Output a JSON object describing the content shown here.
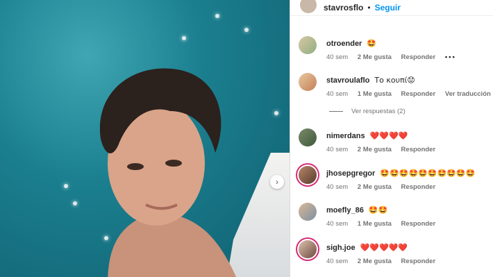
{
  "header": {
    "owner": "stavrosflo",
    "separator": "•",
    "follow_label": "Seguir"
  },
  "comments": [
    {
      "user": "otroender",
      "text": "🤩",
      "time": "40 sem",
      "likes": "2 Me gusta",
      "reply": "Responder",
      "more": "•••"
    },
    {
      "user": "stavroulaflo",
      "text": "Το κουπί😟",
      "time": "40 sem",
      "likes": "1 Me gusta",
      "reply": "Responder",
      "translate": "Ver traducción"
    },
    {
      "user": "nimerdans",
      "text": "❤️❤️❤️❤️",
      "time": "40 sem",
      "likes": "2 Me gusta",
      "reply": "Responder"
    },
    {
      "user": "jhosepgregor",
      "text": "🤩🤩🤩🤩🤩🤩🤩🤩🤩🤩",
      "time": "40 sem",
      "likes": "2 Me gusta",
      "reply": "Responder"
    },
    {
      "user": "moefly_86",
      "text": "🤩🤩",
      "time": "40 sem",
      "likes": "1 Me gusta",
      "reply": "Responder"
    },
    {
      "user": "sigh.joe",
      "text": "❤️❤️❤️❤️❤️",
      "time": "40 sem",
      "likes": "2 Me gusta",
      "reply": "Responder"
    }
  ],
  "view_replies": "Ver respuestas (2)",
  "icons": {
    "carousel_next": "chevron-right-icon"
  },
  "colors": {
    "follow": "#0095f6",
    "meta": "#737373",
    "heart": "#e0245e"
  }
}
